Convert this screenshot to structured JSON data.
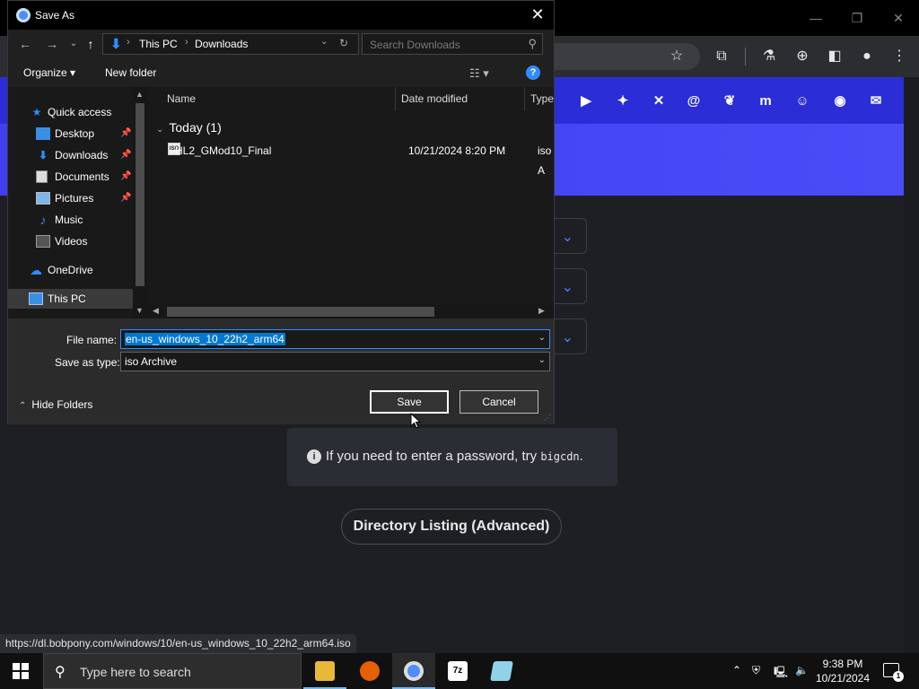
{
  "dialog": {
    "title": "Save As",
    "close_glyph": "✕",
    "address": {
      "crumbs": [
        "This PC",
        "Downloads"
      ]
    },
    "search_placeholder": "Search Downloads",
    "organize_label": "Organize ▾",
    "new_folder_label": "New folder",
    "nav_items": [
      {
        "label": "Quick access",
        "icon": "star-icon",
        "pinned": false
      },
      {
        "label": "Desktop",
        "icon": "desktop-folder-icon",
        "pinned": true
      },
      {
        "label": "Downloads",
        "icon": "download-folder-icon",
        "pinned": true
      },
      {
        "label": "Documents",
        "icon": "documents-folder-icon",
        "pinned": true
      },
      {
        "label": "Pictures",
        "icon": "pictures-folder-icon",
        "pinned": true
      },
      {
        "label": "Music",
        "icon": "music-folder-icon",
        "pinned": false
      },
      {
        "label": "Videos",
        "icon": "videos-folder-icon",
        "pinned": false
      },
      {
        "label": "OneDrive",
        "icon": "cloud-icon",
        "pinned": false
      },
      {
        "label": "This PC",
        "icon": "computer-icon",
        "pinned": false,
        "selected": true
      }
    ],
    "columns": [
      "Name",
      "Date modified",
      "Type"
    ],
    "group_header": "Today (1)",
    "files": [
      {
        "name": "HL2_GMod10_Final",
        "date": "10/21/2024 8:20 PM",
        "type": "iso A",
        "icon_text": "ISO"
      }
    ],
    "file_name_label": "File name:",
    "file_name_value": "en-us_windows_10_22h2_arm64",
    "save_type_label": "Save as type:",
    "save_type_value": "iso Archive",
    "hide_folders_label": "Hide Folders",
    "save_label": "Save",
    "cancel_label": "Cancel",
    "help_glyph": "?"
  },
  "page": {
    "password_hint_prefix": "If you need to enter a password, try",
    "password_code": "bigcdn",
    "password_hint_suffix": ".",
    "info_glyph": "i",
    "directory_button": "Directory Listing (Advanced)",
    "status_url": "https://dl.bobpony.com/windows/10/en-us_windows_10_22h2_arm64.iso",
    "social_icons": [
      "youtube-icon",
      "twitter-icon",
      "x-icon",
      "threads-icon",
      "bluesky-icon",
      "mastodon-icon",
      "discord-icon",
      "github-icon",
      "mail-icon"
    ]
  },
  "taskbar": {
    "search_placeholder": "Type here to search",
    "apps": [
      {
        "name": "file-explorer-icon",
        "label": ""
      },
      {
        "name": "firefox-icon",
        "label": ""
      },
      {
        "name": "chrome-icon",
        "label": "",
        "active": true
      },
      {
        "name": "7zip-icon",
        "label": "7z"
      },
      {
        "name": "notepad-icon",
        "label": ""
      }
    ],
    "time": "9:38 PM",
    "date": "10/21/2024",
    "notification_count": "1"
  },
  "colors": {
    "accent": "#0078d4",
    "site_blue": "#3d3ff0",
    "link_blue": "#4f7bff"
  }
}
